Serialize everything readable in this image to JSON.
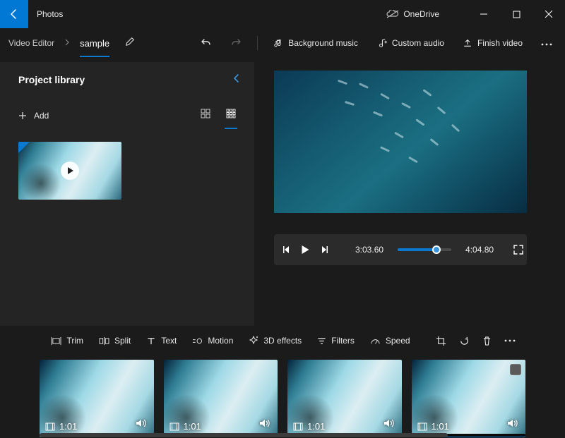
{
  "app_title": "Photos",
  "onedrive_label": "OneDrive",
  "breadcrumb": {
    "root": "Video Editor",
    "project": "sample"
  },
  "top_actions": {
    "bg_music": "Background music",
    "custom_audio": "Custom audio",
    "finish": "Finish video"
  },
  "library": {
    "title": "Project library",
    "add_label": "Add"
  },
  "preview": {
    "current_time": "3:03.60",
    "total_time": "4:04.80",
    "progress_pct": 72
  },
  "storyboard_tools": {
    "trim": "Trim",
    "split": "Split",
    "text": "Text",
    "motion": "Motion",
    "fx3d": "3D effects",
    "filters": "Filters",
    "speed": "Speed"
  },
  "clips": [
    {
      "duration": "1:01",
      "selected": false
    },
    {
      "duration": "1:01",
      "selected": false
    },
    {
      "duration": "1:01",
      "selected": false
    },
    {
      "duration": "1:01",
      "selected": true
    }
  ]
}
